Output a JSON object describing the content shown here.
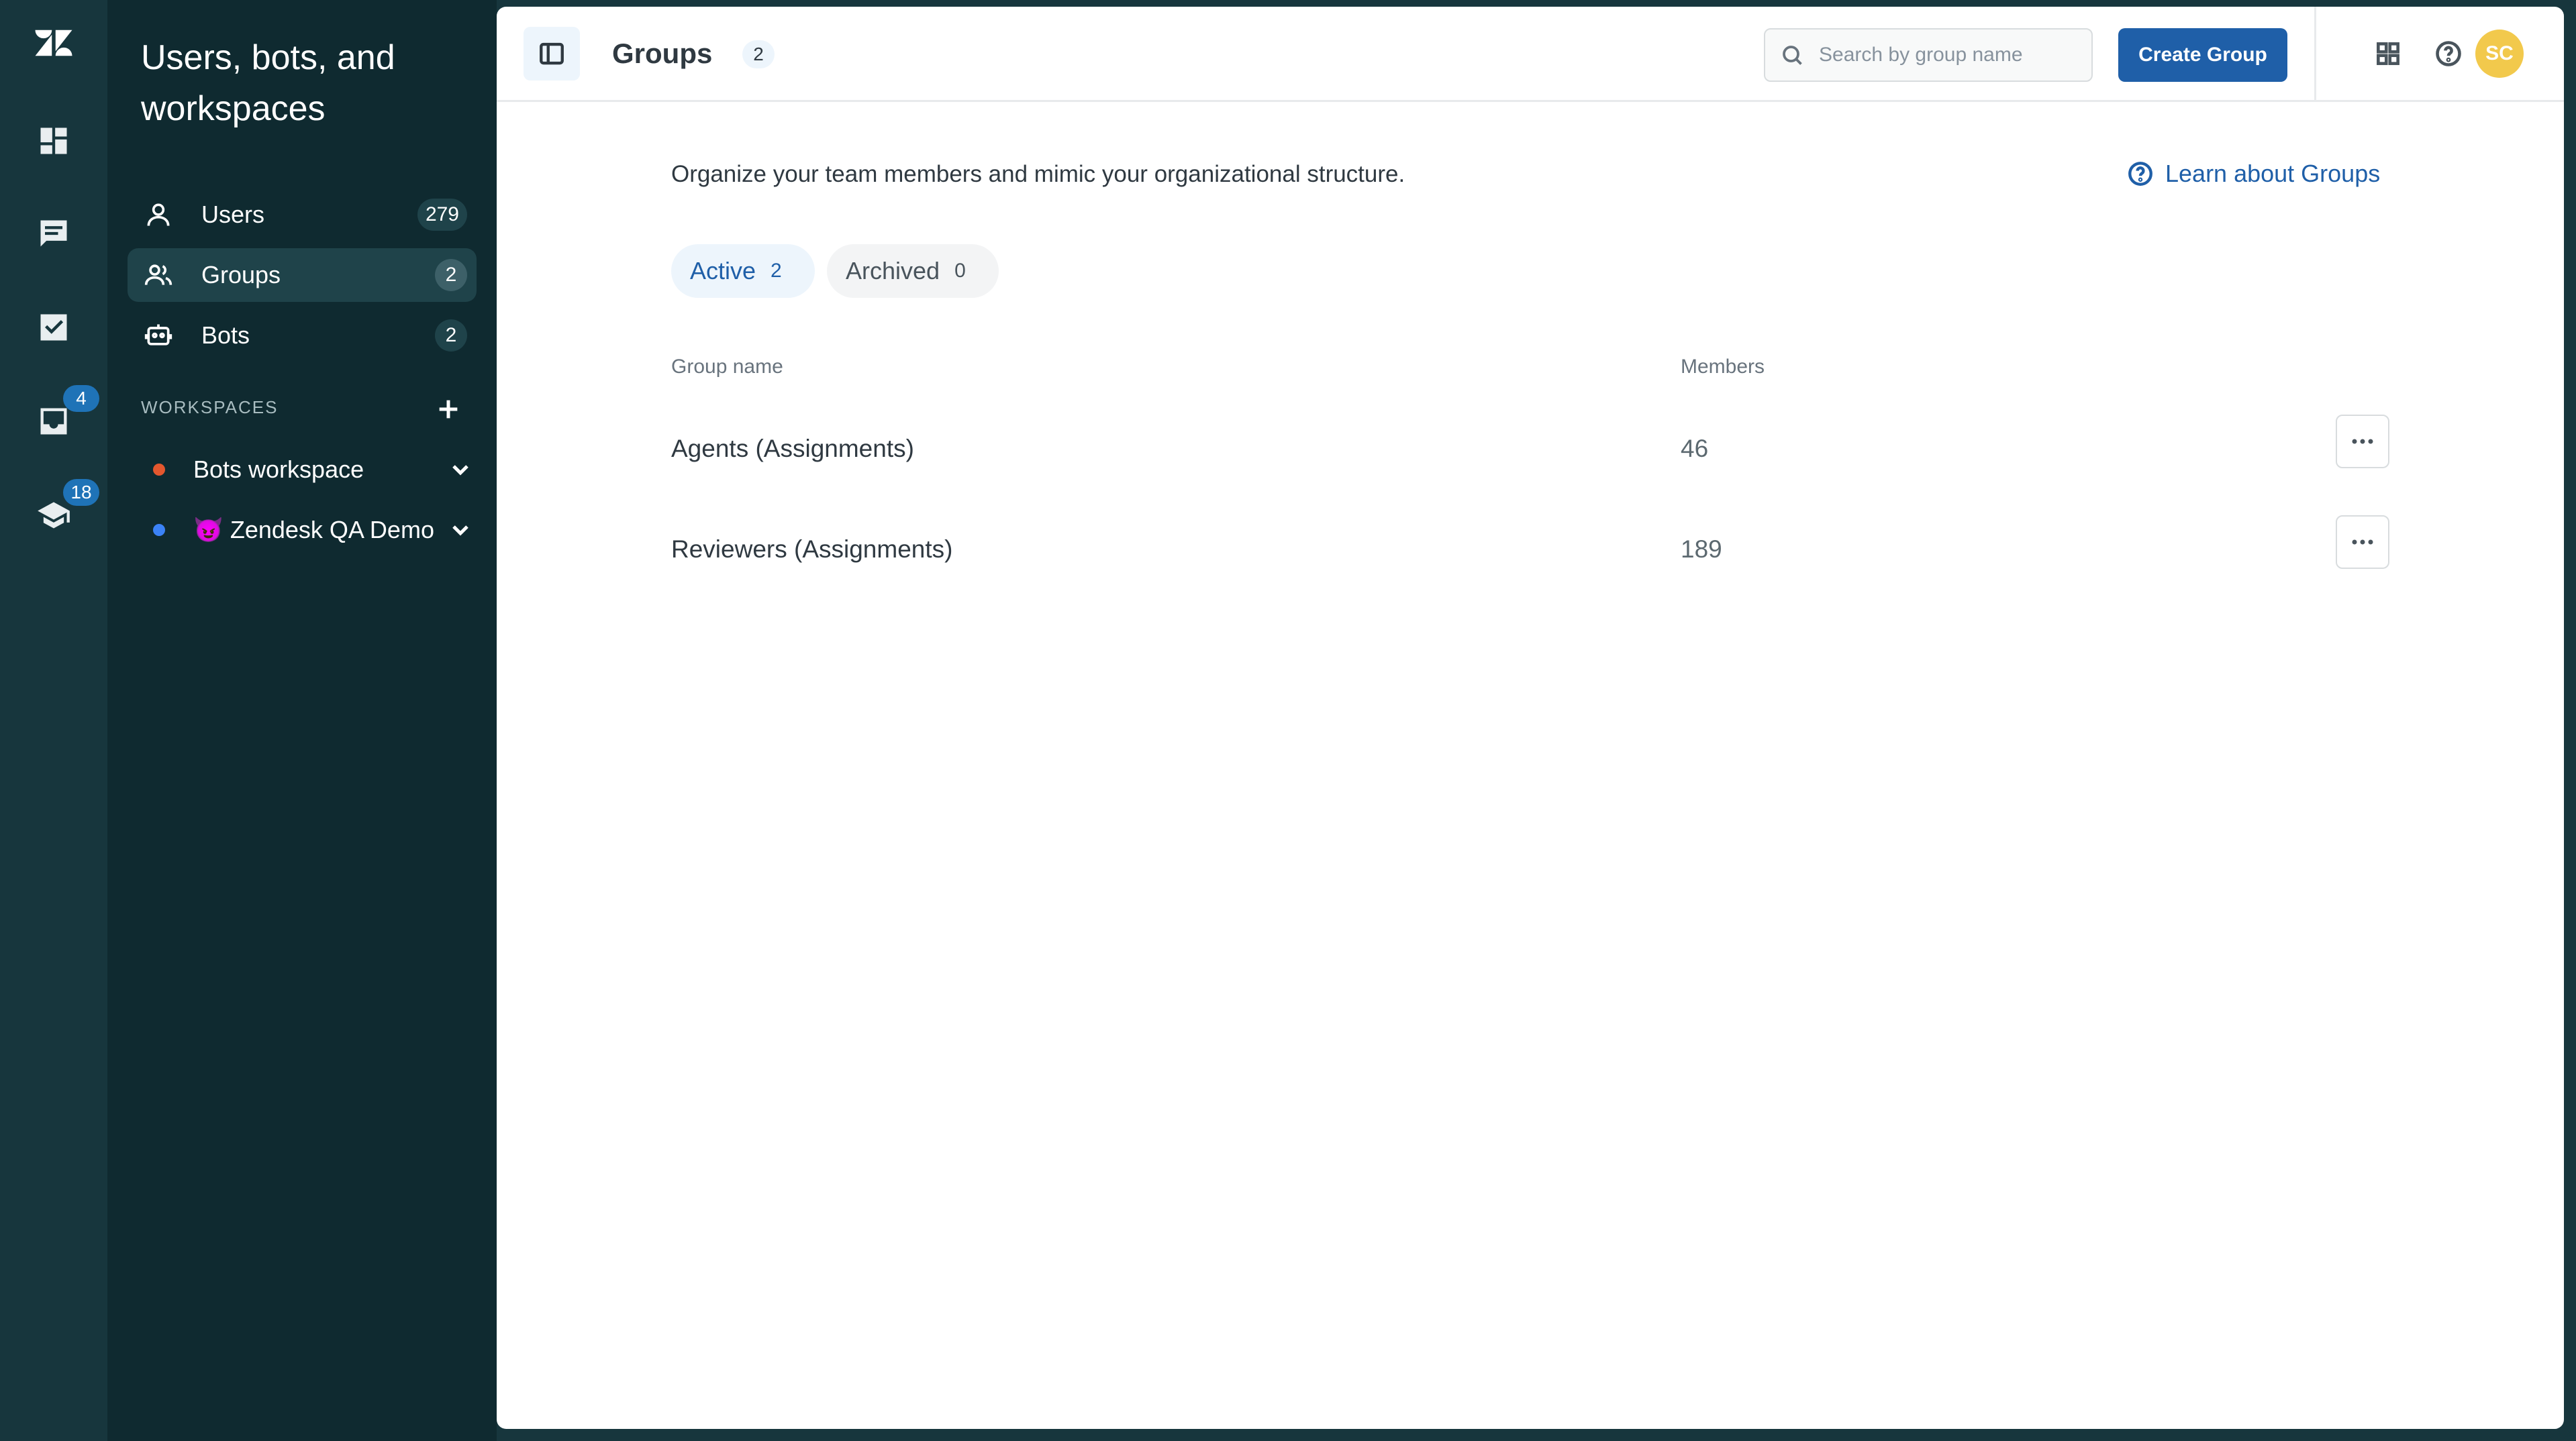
{
  "rail": {
    "items": [
      {
        "name": "dashboard-icon"
      },
      {
        "name": "conversations-icon"
      },
      {
        "name": "tasks-icon"
      },
      {
        "name": "inbox-icon",
        "badge": "4"
      },
      {
        "name": "coaching-icon",
        "badge": "18"
      }
    ]
  },
  "sidebar": {
    "title": "Users, bots, and workspaces",
    "nav": [
      {
        "label": "Users",
        "count": "279",
        "icon": "user-icon"
      },
      {
        "label": "Groups",
        "count": "2",
        "icon": "group-icon",
        "active": true
      },
      {
        "label": "Bots",
        "count": "2",
        "icon": "bot-icon"
      }
    ],
    "workspaces_header": "WORKSPACES",
    "workspaces": [
      {
        "label": "Bots workspace",
        "dot_color": "#e4572e"
      },
      {
        "label": "😈 Zendesk QA Demo",
        "dot_color": "#3b82f6"
      }
    ]
  },
  "header": {
    "title": "Groups",
    "count": "2",
    "search_placeholder": "Search by group name",
    "create_label": "Create Group",
    "avatar_initials": "SC"
  },
  "main": {
    "intro": "Organize your team members and mimic your organizational structure.",
    "learn_link": "Learn about Groups",
    "tabs": [
      {
        "label": "Active",
        "count": "2",
        "active": true
      },
      {
        "label": "Archived",
        "count": "0"
      }
    ],
    "columns": {
      "name": "Group name",
      "members": "Members"
    },
    "rows": [
      {
        "name": "Agents (Assignments)",
        "members": "46"
      },
      {
        "name": "Reviewers (Assignments)",
        "members": "189"
      }
    ]
  },
  "colors": {
    "sidebar_bg": "#0f2a30",
    "rail_bg": "#17363d",
    "accent": "#1f5fa8",
    "avatar": "#f2c94c"
  }
}
